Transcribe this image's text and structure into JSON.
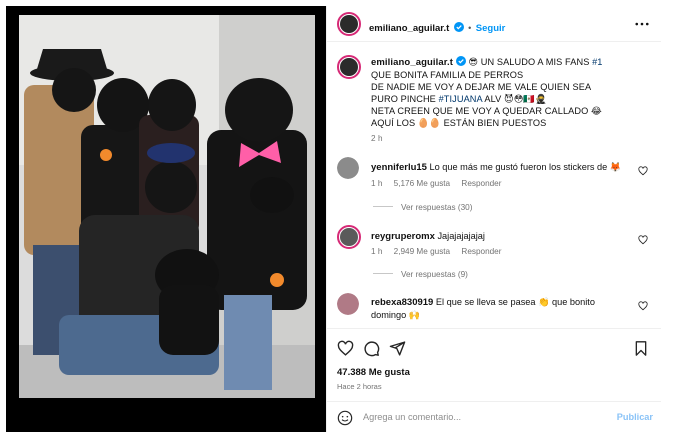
{
  "post": {
    "username": "emiliano_aguilar.t",
    "follow_label": "Seguir",
    "separator": "•",
    "caption_lines": [
      "QUE BONITA FAMILIA DE PERROS",
      "DE NADIE ME VOY A DEJAR ME VALE QUIEN SEA",
      "PURO PINCHE",
      "NETA CREEN QUE ME VOY A QUEDAR CALLADO 😂",
      "AQUÍ LOS 🥚🥚 ESTÁN BIEN PUESTOS"
    ],
    "caption_first": "UN SALUDO A MIS FANS",
    "caption_hashtag1": "#1",
    "caption_hashtag2": "#TIJUANA",
    "caption_alv": "ALV 😈😳🇲🇽🥷",
    "caption_emoji_prefix": "😎",
    "age": "2 h"
  },
  "comments": [
    {
      "user": "yenniferlu15",
      "text": "Lo que más me gustó fueron los stickers de 🦊",
      "time": "1 h",
      "likes": "5,176 Me gusta",
      "reply": "Responder",
      "replies": "Ver respuestas (30)"
    },
    {
      "user": "reygruperomx",
      "text": "Jajajajajajaj",
      "time": "1 h",
      "likes": "2,949 Me gusta",
      "reply": "Responder",
      "replies": "Ver respuestas (9)"
    },
    {
      "user": "rebexa830919",
      "text_a": "El que se lleva se pasea 👏 que bonito",
      "text_b": "domingo 🙌"
    }
  ],
  "actions": {
    "likes": "47.388 Me gusta",
    "time": "Hace 2 horas",
    "comment_placeholder": "Agrega un comentario...",
    "publish": "Publicar"
  },
  "icons": {
    "more": "more-horizontal-icon",
    "like": "heart-icon",
    "comment": "comment-icon",
    "share": "share-icon",
    "save": "bookmark-icon",
    "emoji": "emoji-icon",
    "verified": "verified-badge-icon"
  },
  "colors": {
    "accent": "#0095f6",
    "hashtag": "#00376b",
    "muted": "#737373",
    "publish_disabled": "#8ac3f7"
  }
}
